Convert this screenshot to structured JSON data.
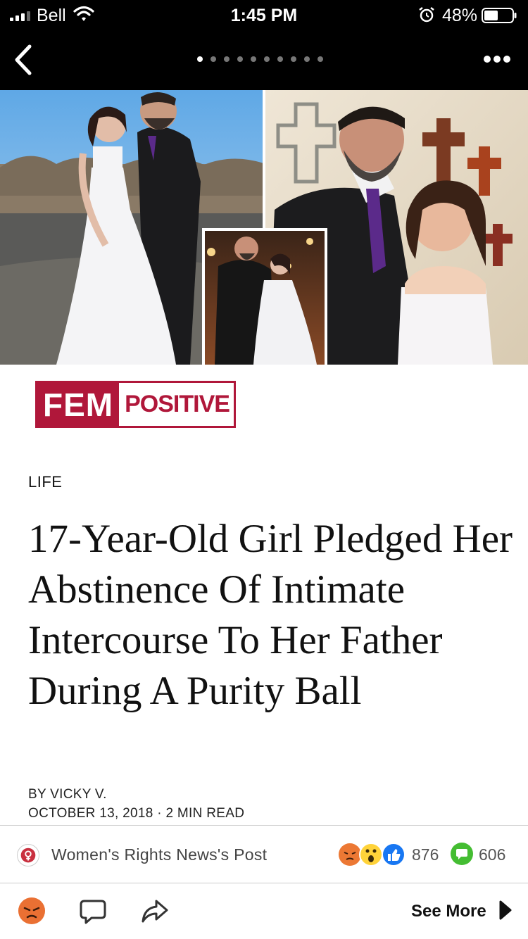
{
  "status_bar": {
    "carrier": "Bell",
    "time": "1:45 PM",
    "battery": "48%"
  },
  "nav": {
    "page_count": 10,
    "active_page": 1
  },
  "logo": {
    "part1": "FEM",
    "part2": "POSITIVE"
  },
  "article": {
    "category": "LIFE",
    "headline": "17-Year-Old Girl Pledged Her Abstinence Of Intimate Intercourse To Her Father During A Purity Ball",
    "byline": "BY VICKY V.",
    "date": "OCTOBER 13, 2018",
    "read_time": "2 MIN READ",
    "date_separator": "·"
  },
  "post": {
    "source": "Women's Rights News's Post",
    "reaction_count": "876",
    "comment_count": "606"
  },
  "actions": {
    "see_more": "See More"
  },
  "colors": {
    "brand_red": "#b0173a",
    "fb_blue": "#1877f2",
    "comment_green": "#44bd32",
    "angry_orange": "#f0893a"
  }
}
